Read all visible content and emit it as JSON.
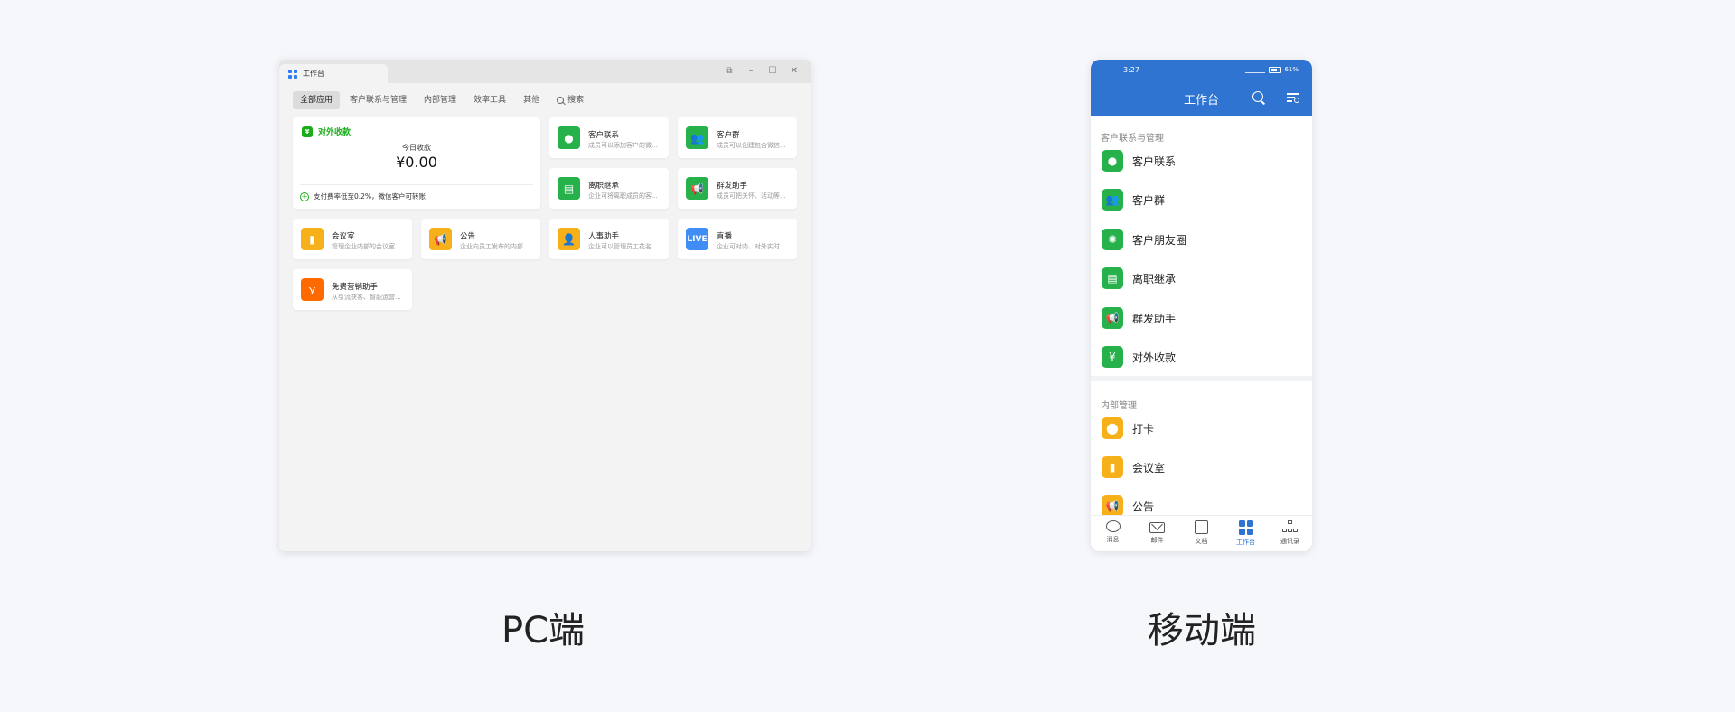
{
  "pc": {
    "tab_title": "工作台",
    "nav": [
      "全部应用",
      "客户联系与管理",
      "内部管理",
      "效率工具",
      "其他"
    ],
    "search_label": "搜索",
    "payment": {
      "title": "对外收款",
      "subtitle": "今日收款",
      "amount": "¥0.00",
      "note": "支付费率低至0.2%，微信客户可转账"
    },
    "apps": [
      {
        "name": "客户联系",
        "desc": "成员可以添加客户的微信..."
      },
      {
        "name": "客户群",
        "desc": "成员可以创建包含微信..."
      },
      {
        "name": "离职继承",
        "desc": "企业可将离职成员的客..."
      },
      {
        "name": "群发助手",
        "desc": "成员可把关怀、活动等..."
      },
      {
        "name": "会议室",
        "desc": "管理企业内部的会议室..."
      },
      {
        "name": "公告",
        "desc": "企业向员工发布的内部..."
      },
      {
        "name": "人事助手",
        "desc": "企业可以管理员工花名..."
      },
      {
        "name": "直播",
        "desc": "企业可对内、对外实时..."
      },
      {
        "name": "免费营销助手",
        "desc": "从引流获客、智能运营..."
      }
    ],
    "live_label": "LIVE"
  },
  "mobile": {
    "status": {
      "time": "3:27",
      "battery": "61%"
    },
    "title": "工作台",
    "section1_title": "客户联系与管理",
    "section1_items": [
      "客户联系",
      "客户群",
      "客户朋友圈",
      "离职继承",
      "群发助手",
      "对外收款"
    ],
    "section2_title": "内部管理",
    "section2_items": [
      "打卡",
      "会议室",
      "公告"
    ],
    "tabs": [
      "消息",
      "邮件",
      "文档",
      "工作台",
      "通讯录"
    ]
  },
  "captions": {
    "pc": "PC端",
    "mobile": "移动端"
  },
  "colors": {
    "green": "#27b14b",
    "yellow": "#f6b11a",
    "blue_header": "#2f74d0",
    "live_blue": "#3f8df5",
    "orange": "#ff6a00"
  }
}
